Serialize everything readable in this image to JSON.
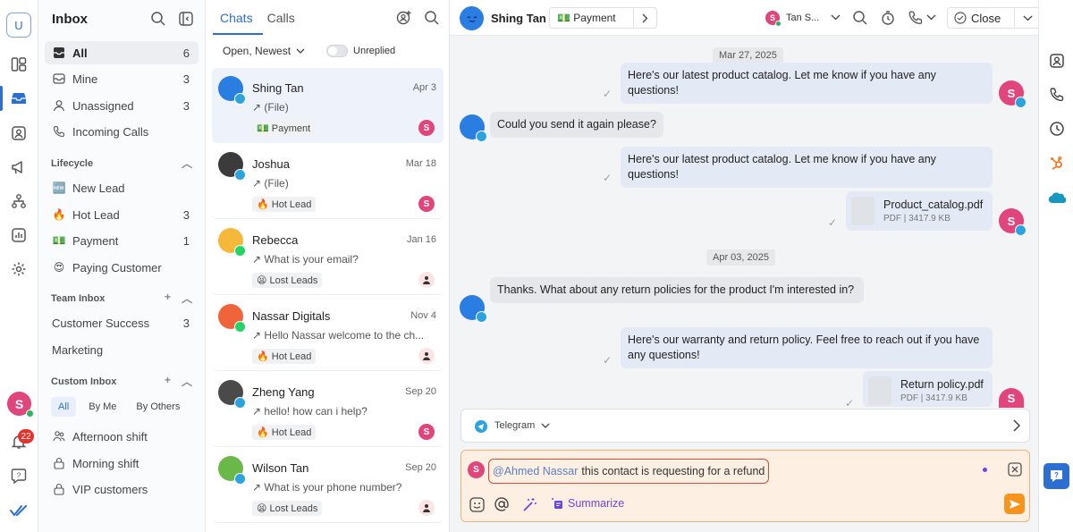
{
  "workspace_initial": "U",
  "user_initial": "S",
  "notification_count": "22",
  "inbox": {
    "title": "Inbox",
    "items": [
      {
        "label": "All",
        "count": "6"
      },
      {
        "label": "Mine",
        "count": "3"
      },
      {
        "label": "Unassigned",
        "count": "3"
      },
      {
        "label": "Incoming Calls",
        "count": ""
      }
    ],
    "lifecycle_title": "Lifecycle",
    "lifecycle": [
      {
        "emoji": "🆕",
        "label": "New Lead",
        "count": ""
      },
      {
        "emoji": "🔥",
        "label": "Hot Lead",
        "count": "3"
      },
      {
        "emoji": "💵",
        "label": "Payment",
        "count": "1"
      },
      {
        "emoji": "😍",
        "label": "Paying Customer",
        "count": ""
      }
    ],
    "team_title": "Team Inbox",
    "team": [
      {
        "label": "Customer Success",
        "count": "3"
      },
      {
        "label": "Marketing",
        "count": ""
      }
    ],
    "custom_title": "Custom Inbox",
    "filters": [
      "All",
      "By Me",
      "By Others"
    ],
    "custom": [
      {
        "label": "Afternoon shift"
      },
      {
        "label": "Morning shift"
      },
      {
        "label": "VIP customers"
      }
    ]
  },
  "list": {
    "tabs": [
      "Chats",
      "Calls"
    ],
    "sort": "Open, Newest",
    "unreplied": "Unreplied",
    "chats": [
      {
        "name": "Shing Tan",
        "date": "Apr 3",
        "preview": "↗ (File)",
        "tag": "💵 Payment",
        "assignee": "S",
        "channel": "telegram"
      },
      {
        "name": "Joshua",
        "date": "Mar 18",
        "preview": "↗ (File)",
        "tag": "🔥 Hot Lead",
        "assignee": "S",
        "channel": "telegram"
      },
      {
        "name": "Rebecca",
        "date": "Jan 16",
        "preview": "↗ What is your email?",
        "tag": "😫 Lost Leads",
        "assignee": "",
        "channel": "whatsapp"
      },
      {
        "name": "Nassar Digitals",
        "date": "Nov 4",
        "preview": "↗ Hello Nassar welcome to the ch...",
        "tag": "🔥 Hot Lead",
        "assignee": "",
        "channel": "whatsapp"
      },
      {
        "name": "Zheng Yang",
        "date": "Sep 20",
        "preview": "↗ hello! how can i help?",
        "tag": "🔥 Hot Lead",
        "assignee": "S",
        "channel": "telegram"
      },
      {
        "name": "Wilson Tan",
        "date": "Sep 20",
        "preview": "↗ What is your phone number?",
        "tag": "😫 Lost Leads",
        "assignee": "",
        "channel": "telegram"
      }
    ]
  },
  "conversation": {
    "contact": "Shing Tan",
    "lifecycle": "💵 Payment",
    "assignee": "Tan S...",
    "close_label": "Close",
    "dates": [
      "Mar 27, 2025",
      "Apr 03, 2025"
    ],
    "messages": [
      {
        "dir": "out",
        "text": "Here's our latest product catalog. Let me know if you have any questions!"
      },
      {
        "dir": "in",
        "text": "Could you send it again please?"
      },
      {
        "dir": "out",
        "text": "Here's our latest product catalog. Let me know if you have any questions!"
      },
      {
        "dir": "in",
        "text": "Thanks. What about any return policies for the product I'm interested in?"
      },
      {
        "dir": "out",
        "text": "Here's our warranty and return policy. Feel free to reach out if you have any questions!"
      }
    ],
    "files": [
      {
        "name": "Product_catalog.pdf",
        "type": "PDF",
        "size": "3417.9 KB"
      },
      {
        "name": "Return policy.pdf",
        "type": "PDF",
        "size": "3417.9 KB"
      }
    ],
    "channel": "Telegram",
    "composer": {
      "mention": "@Ahmed Nassar",
      "text": "this contact is requesting for a refund",
      "summarize": "Summarize"
    }
  },
  "colors": {
    "accent": "#2d6fd0",
    "assignee": "#e0457b",
    "telegram": "#2aa3df",
    "whatsapp": "#25d366",
    "send": "#f7941d"
  }
}
